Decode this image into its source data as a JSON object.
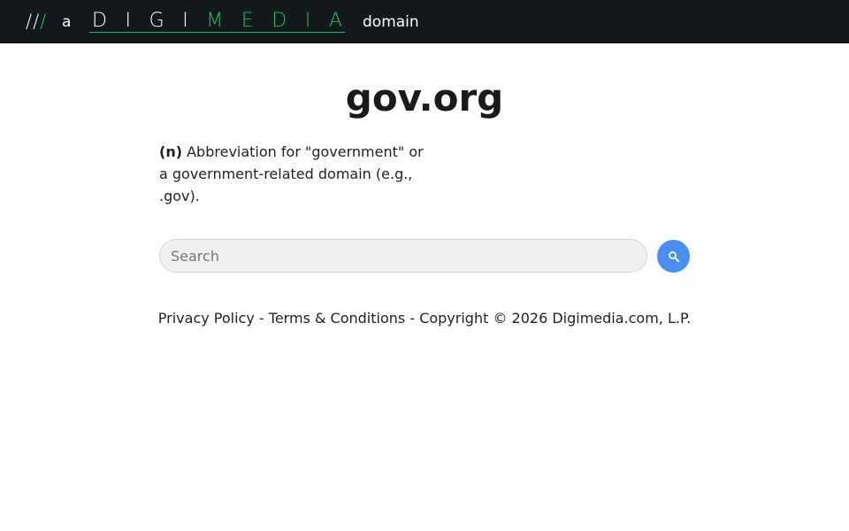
{
  "header": {
    "slashes_white": "//",
    "slashes_green": "/",
    "article": "a",
    "brand_letters": [
      {
        "char": "D",
        "color": "#ffffff"
      },
      {
        "char": "I",
        "color": "#ffffff"
      },
      {
        "char": "G",
        "color": "#ffffff"
      },
      {
        "char": "I",
        "color": "#ffffff"
      },
      {
        "char": "M",
        "color": "#19c165"
      },
      {
        "char": "E",
        "color": "#19c165"
      },
      {
        "char": "D",
        "color": "#19c165"
      },
      {
        "char": "I",
        "color": "#19c165"
      },
      {
        "char": "A",
        "color": "#19c165"
      }
    ],
    "domain_word": "domain",
    "background_color": "#13191a",
    "accent_color": "#19c165"
  },
  "main": {
    "title": "gov.org",
    "definition": {
      "part_of_speech": "(n)",
      "text": "Abbreviation for \"government\" or a government-related domain (e.g., .gov)."
    }
  },
  "search": {
    "placeholder": "Search",
    "value": "",
    "button_icon": "search-icon",
    "button_color": "#4b8ef2"
  },
  "footer": {
    "privacy_label": "Privacy Policy",
    "separator": " - ",
    "terms_label": "Terms & Conditions",
    "copyright": "Copyright © 2026 Digimedia.com, L.P."
  }
}
